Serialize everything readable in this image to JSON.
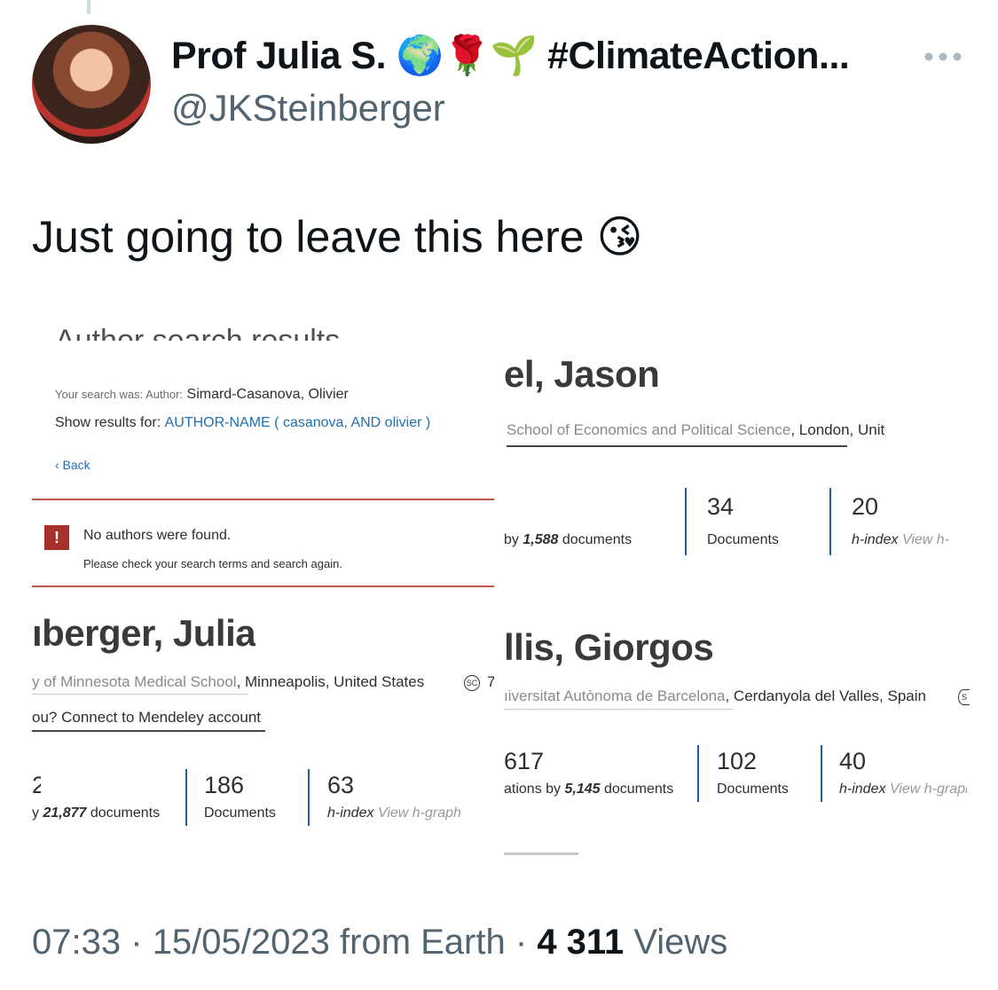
{
  "tweet": {
    "display_name": "Prof Julia S. 🌍🌹🌱 #ClimateAction...",
    "handle": "@JKSteinberger",
    "text": "Just going to leave this here 😘",
    "time": "07:33",
    "date": "15/05/2023",
    "source": "from Earth",
    "views_count": "4 311",
    "views_label": "Views",
    "separator": "·",
    "more_icon": "more-horizontal-icon"
  },
  "screenshot": {
    "search_panel": {
      "heading_partial": "Author search results",
      "search_was_label": "Your search was: Author:",
      "search_was_value": "Simard-Casanova, Olivier",
      "show_results_label": "Show results for:",
      "show_results_value": "AUTHOR-NAME ( casanova,  AND olivier )",
      "back_label": "‹ Back",
      "alert_icon": "!",
      "alert_title": "No authors were found.",
      "alert_detail": "Please check your search terms and search again."
    },
    "profiles": [
      {
        "name": "ıberger, Julia",
        "affiliation_link": "y of Minnesota Medical School",
        "affiliation_rest": ", Minneapolis, United States",
        "extra": "ou? Connect to Mendeley account",
        "sc_icon": "SC",
        "sc_after": "7",
        "citations_value": "2",
        "citations_label": "y ",
        "citations_docs": "21,877",
        "citations_suffix": " documents",
        "documents": "186",
        "documents_label": "Documents",
        "h_index": "63",
        "h_index_label": "h-index",
        "h_graph": "View h-graph"
      },
      {
        "name": "el, Jason",
        "affiliation_link": "School of Economics and Political Science",
        "affiliation_rest": ", London, Unit",
        "citations_label": "by ",
        "citations_docs": "1,588",
        "citations_suffix": " documents",
        "documents": "34",
        "documents_label": "Documents",
        "h_index": "20",
        "h_index_label": "h-index",
        "h_graph": "View h-"
      },
      {
        "name": "llis, Giorgos",
        "affiliation_link": "ıiversitat Autònoma de Barcelona",
        "affiliation_rest": ", Cerdanyola del Valles, Spain",
        "sc_icon": "S",
        "citations_value": "617",
        "citations_label": "ations by ",
        "citations_docs": "5,145",
        "citations_suffix": " documents",
        "documents": "102",
        "documents_label": "Documents",
        "h_index": "40",
        "h_index_label": "h-index",
        "h_graph": "View h-graph"
      }
    ]
  }
}
